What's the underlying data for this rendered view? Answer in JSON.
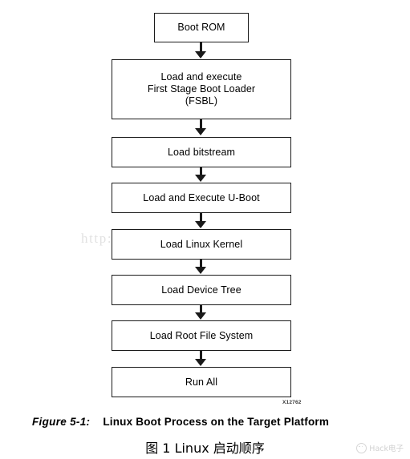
{
  "diagram": {
    "type": "flowchart",
    "orientation": "vertical",
    "watermark": "http://blog.csdn.net/zhaoxinfan",
    "figure_id": "X12762",
    "nodes": [
      {
        "id": "boot-rom",
        "label": "Boot ROM"
      },
      {
        "id": "fsbl",
        "label": "Load and execute\nFirst Stage Boot Loader\n(FSBL)"
      },
      {
        "id": "bitstream",
        "label": "Load bitstream"
      },
      {
        "id": "uboot",
        "label": "Load and Execute U-Boot"
      },
      {
        "id": "kernel",
        "label": "Load Linux Kernel"
      },
      {
        "id": "devtree",
        "label": "Load Device Tree"
      },
      {
        "id": "rootfs",
        "label": "Load Root File System"
      },
      {
        "id": "runall",
        "label": "Run All"
      }
    ]
  },
  "caption": {
    "figure_number": "Figure 5-1:",
    "figure_title": "Linux Boot Process on the Target Platform",
    "chinese": "图 1 Linux 启动顺序"
  },
  "badge": {
    "icon": "wechat-icon",
    "label": "Hack电子"
  },
  "colors": {
    "box_border": "#1a1a1a",
    "text": "#000000",
    "watermark": "#e2e2e2",
    "background": "#ffffff",
    "badge_text": "#c9c9c9"
  }
}
